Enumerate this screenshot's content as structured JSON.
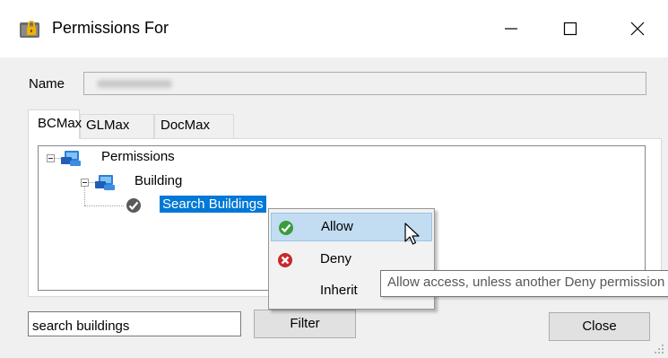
{
  "window": {
    "title": "Permissions For"
  },
  "form": {
    "name_label": "Name",
    "name_value": ""
  },
  "tabs": [
    {
      "label": "BCMax",
      "active": true
    },
    {
      "label": "GLMax",
      "active": false
    },
    {
      "label": "DocMax",
      "active": false
    }
  ],
  "tree": {
    "root": "Permissions",
    "child": "Building",
    "leaf": "Search Buildings"
  },
  "context_menu": {
    "items": [
      {
        "label": "Allow",
        "icon": "green-check-icon",
        "highlighted": true
      },
      {
        "label": "Deny",
        "icon": "red-x-icon",
        "highlighted": false
      },
      {
        "label": "Inherit",
        "icon": "",
        "highlighted": false
      }
    ]
  },
  "tooltip": {
    "text": "Allow access, unless another Deny permission"
  },
  "filter": {
    "value": "search buildings",
    "button_label": "Filter"
  },
  "footer": {
    "close_label": "Close"
  },
  "colors": {
    "selection": "#0078d7",
    "menu_highlight": "#c2dcf2",
    "allow_green": "#3b9b3b",
    "deny_red": "#c8282d"
  }
}
